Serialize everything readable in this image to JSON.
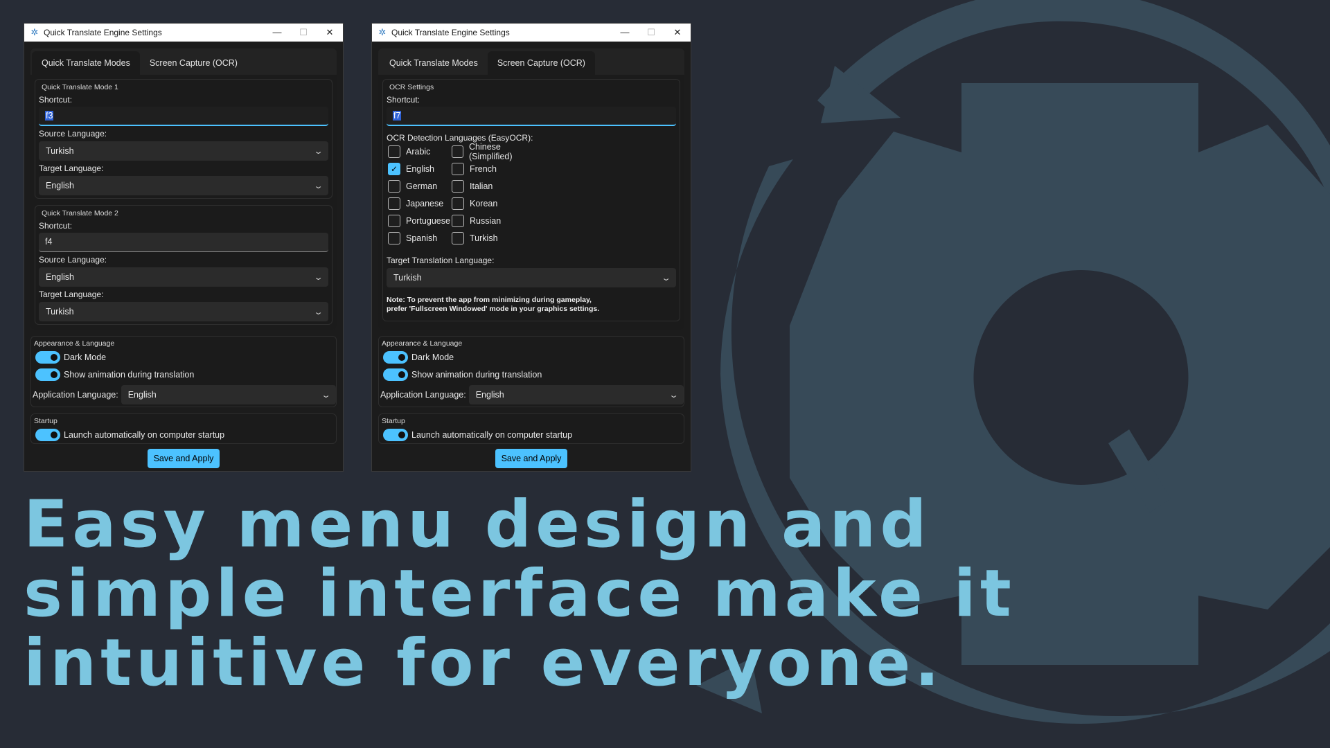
{
  "colors": {
    "background": "#272c36",
    "logo": "#374a58",
    "accent": "#4cc2ff",
    "headline": "#7cc6e0"
  },
  "window_title": "Quick Translate Engine Settings",
  "window_controls": {
    "minimize": "—",
    "maximize": "☐",
    "close": "✕"
  },
  "app_icon": "gear-icon",
  "tabs": {
    "modes": "Quick Translate Modes",
    "ocr": "Screen Capture (OCR)"
  },
  "modes_tab": {
    "mode1": {
      "title": "Quick Translate Mode 1",
      "shortcut_label": "Shortcut:",
      "shortcut_value": "f3",
      "source_label": "Source Language:",
      "source_value": "Turkish",
      "target_label": "Target Language:",
      "target_value": "English"
    },
    "mode2": {
      "title": "Quick Translate Mode 2",
      "shortcut_label": "Shortcut:",
      "shortcut_value": "f4",
      "source_label": "Source Language:",
      "source_value": "English",
      "target_label": "Target Language:",
      "target_value": "Turkish"
    }
  },
  "ocr_tab": {
    "title": "OCR Settings",
    "shortcut_label": "Shortcut:",
    "shortcut_value": "f7",
    "languages_label": "OCR Detection Languages (EasyOCR):",
    "languages": [
      {
        "label": "Arabic",
        "checked": false
      },
      {
        "label": "Chinese (Simplified)",
        "checked": false
      },
      {
        "label": "English",
        "checked": true
      },
      {
        "label": "French",
        "checked": false
      },
      {
        "label": "German",
        "checked": false
      },
      {
        "label": "Italian",
        "checked": false
      },
      {
        "label": "Japanese",
        "checked": false
      },
      {
        "label": "Korean",
        "checked": false
      },
      {
        "label": "Portuguese",
        "checked": false
      },
      {
        "label": "Russian",
        "checked": false
      },
      {
        "label": "Spanish",
        "checked": false
      },
      {
        "label": "Turkish",
        "checked": false
      }
    ],
    "target_label": "Target Translation Language:",
    "target_value": "Turkish",
    "note_line1": "Note: To prevent the app from minimizing during gameplay,",
    "note_line2": "prefer 'Fullscreen Windowed' mode in your graphics settings."
  },
  "appearance": {
    "title": "Appearance & Language",
    "dark_mode": "Dark Mode",
    "dark_mode_on": true,
    "animation": "Show animation during translation",
    "animation_on": true,
    "app_language_label": "Application Language:",
    "app_language_value": "English"
  },
  "startup": {
    "title": "Startup",
    "launch": "Launch automatically on computer startup",
    "launch_on": true
  },
  "save_button": "Save and Apply",
  "headline": {
    "line1": "Easy menu design and",
    "line2": "simple interface make it",
    "line3": "intuitive for everyone."
  }
}
